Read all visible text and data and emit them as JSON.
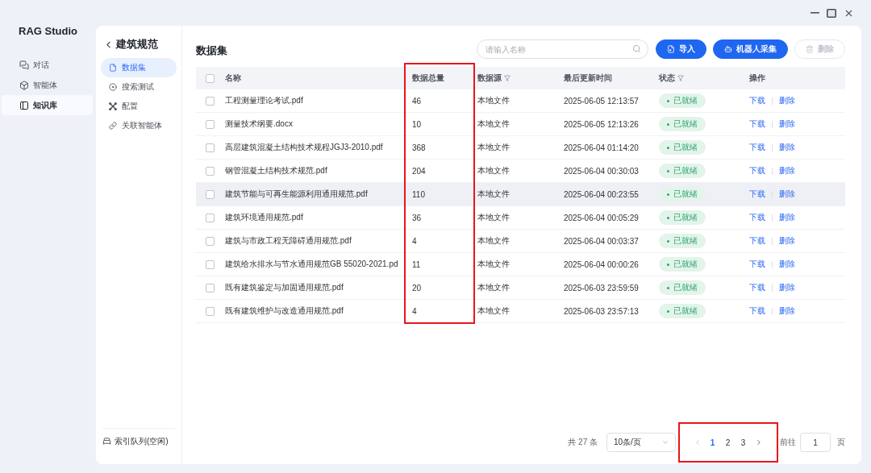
{
  "window": {
    "app_name": "RAG Studio"
  },
  "nav": [
    {
      "label": "对话",
      "kind": "chat",
      "selected": false
    },
    {
      "label": "智能体",
      "kind": "agent",
      "selected": false
    },
    {
      "label": "知识库",
      "kind": "library",
      "selected": true
    }
  ],
  "knowledge_base": {
    "title": "建筑规范",
    "menu": [
      {
        "label": "数据集",
        "kind": "dataset",
        "selected": true
      },
      {
        "label": "搜索测试",
        "kind": "search_test",
        "selected": false
      },
      {
        "label": "配置",
        "kind": "config",
        "selected": false
      },
      {
        "label": "关联智能体",
        "kind": "link",
        "selected": false
      }
    ],
    "queue_status": "索引队列(空闲)"
  },
  "dataset": {
    "title": "数据集",
    "search": {
      "placeholder": "请输入名称"
    },
    "buttons": [
      {
        "label": "导入",
        "kind": "import",
        "disabled": false
      },
      {
        "label": "机器人采集",
        "kind": "robot",
        "disabled": false
      },
      {
        "label": "删除",
        "kind": "delete",
        "disabled": true
      }
    ],
    "table": {
      "select_all_checked": false,
      "columns": [
        {
          "label": "名称",
          "filterable": false,
          "highlighted": false
        },
        {
          "label": "数据总量",
          "filterable": false,
          "highlighted": true
        },
        {
          "label": "数据源",
          "filterable": true,
          "highlighted": false
        },
        {
          "label": "最后更新时间",
          "filterable": false,
          "highlighted": false
        },
        {
          "label": "状态",
          "filterable": true,
          "highlighted": false
        },
        {
          "label": "操作",
          "filterable": false,
          "highlighted": false
        }
      ],
      "rows": [
        {
          "checked": false,
          "hovered": false,
          "name": "工程测量理论考试.pdf",
          "count": "46",
          "source": "本地文件",
          "updated": "2025-06-05 12:13:57",
          "status": {
            "label": "已就绪",
            "kind": "ready"
          },
          "actions": [
            "下载",
            "删除"
          ]
        },
        {
          "checked": false,
          "hovered": false,
          "name": "测量技术纲要.docx",
          "count": "10",
          "source": "本地文件",
          "updated": "2025-06-05 12:13:26",
          "status": {
            "label": "已就绪",
            "kind": "ready"
          },
          "actions": [
            "下载",
            "删除"
          ]
        },
        {
          "checked": false,
          "hovered": false,
          "name": "高层建筑混凝土结构技术规程JGJ3-2010.pdf",
          "count": "368",
          "source": "本地文件",
          "updated": "2025-06-04 01:14:20",
          "status": {
            "label": "已就绪",
            "kind": "ready"
          },
          "actions": [
            "下载",
            "删除"
          ]
        },
        {
          "checked": false,
          "hovered": false,
          "name": "钢管混凝土结构技术规范.pdf",
          "count": "204",
          "source": "本地文件",
          "updated": "2025-06-04 00:30:03",
          "status": {
            "label": "已就绪",
            "kind": "ready"
          },
          "actions": [
            "下载",
            "删除"
          ]
        },
        {
          "checked": false,
          "hovered": true,
          "name": "建筑节能与可再生能源利用通用规范.pdf",
          "count": "110",
          "source": "本地文件",
          "updated": "2025-06-04 00:23:55",
          "status": {
            "label": "已就绪",
            "kind": "ready"
          },
          "actions": [
            "下载",
            "删除"
          ]
        },
        {
          "checked": false,
          "hovered": false,
          "name": "建筑环境通用规范.pdf",
          "count": "36",
          "source": "本地文件",
          "updated": "2025-06-04 00:05:29",
          "status": {
            "label": "已就绪",
            "kind": "ready"
          },
          "actions": [
            "下载",
            "删除"
          ]
        },
        {
          "checked": false,
          "hovered": false,
          "name": "建筑与市政工程无障碍通用规范.pdf",
          "count": "4",
          "source": "本地文件",
          "updated": "2025-06-04 00:03:37",
          "status": {
            "label": "已就绪",
            "kind": "ready"
          },
          "actions": [
            "下载",
            "删除"
          ]
        },
        {
          "checked": false,
          "hovered": false,
          "name": "建筑给水排水与节水通用规范GB 55020-2021.pd",
          "count": "11",
          "source": "本地文件",
          "updated": "2025-06-04 00:00:26",
          "status": {
            "label": "已就绪",
            "kind": "ready"
          },
          "actions": [
            "下载",
            "删除"
          ]
        },
        {
          "checked": false,
          "hovered": false,
          "name": "既有建筑鉴定与加固通用规范.pdf",
          "count": "20",
          "source": "本地文件",
          "updated": "2025-06-03 23:59:59",
          "status": {
            "label": "已就绪",
            "kind": "ready"
          },
          "actions": [
            "下载",
            "删除"
          ]
        },
        {
          "checked": false,
          "hovered": false,
          "name": "既有建筑维护与改造通用规范.pdf",
          "count": "4",
          "source": "本地文件",
          "updated": "2025-06-03 23:57:13",
          "status": {
            "label": "已就绪",
            "kind": "ready"
          },
          "actions": [
            "下载",
            "删除"
          ]
        }
      ]
    },
    "pagination": {
      "total": "共 27 条",
      "page_size": "10条/页",
      "prev_disabled": true,
      "next_disabled": false,
      "pages": [
        {
          "label": "1",
          "selected": true
        },
        {
          "label": "2",
          "selected": false
        },
        {
          "label": "3",
          "selected": false
        }
      ],
      "highlighted": true,
      "goto_label": "前往",
      "goto_value": "1",
      "goto_unit": "页"
    }
  }
}
